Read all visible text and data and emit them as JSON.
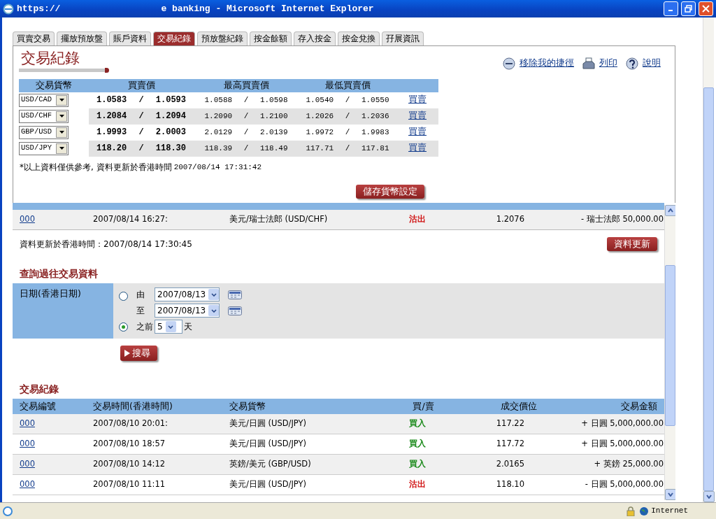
{
  "window": {
    "title_start": "https://",
    "title_end": "e banking - Microsoft Internet Explorer"
  },
  "tabs": [
    {
      "label": "買賣交易",
      "selected": false
    },
    {
      "label": "擺放預放盤",
      "selected": false
    },
    {
      "label": "賬戶資料",
      "selected": false
    },
    {
      "label": "交易紀錄",
      "selected": true
    },
    {
      "label": "預放盤紀錄",
      "selected": false
    },
    {
      "label": "按金餘額",
      "selected": false
    },
    {
      "label": "存入按金",
      "selected": false
    },
    {
      "label": "按金兌換",
      "selected": false
    },
    {
      "label": "孖展資訊",
      "selected": false
    }
  ],
  "page_title": "交易紀錄",
  "links": [
    {
      "label": "移除我的捷徑"
    },
    {
      "label": "列印"
    },
    {
      "label": "說明"
    }
  ],
  "rates": {
    "columns": [
      "交易貨幣",
      "買賣價",
      "最高買賣價",
      "最低買賣價"
    ],
    "rows": [
      {
        "pair": "USD/CAD",
        "price": "1.0583 / 1.0593",
        "high": "1.0588 / 1.0598",
        "low": "1.0540 / 1.0550",
        "action": "買賣"
      },
      {
        "pair": "USD/CHF",
        "price": "1.2084 / 1.2094",
        "high": "1.2090 / 1.2100",
        "low": "1.2026 / 1.2036",
        "action": "買賣"
      },
      {
        "pair": "GBP/USD",
        "price": "1.9993 / 2.0003",
        "high": "2.0129 / 2.0139",
        "low": "1.9972 / 1.9983",
        "action": "買賣"
      },
      {
        "pair": "USD/JPY",
        "price": "118.20 / 118.30",
        "high": "118.39 / 118.49",
        "low": "117.71 / 117.81",
        "action": "買賣"
      }
    ],
    "note": "*以上資料僅供參考, 資料更新於香港時間",
    "note_time": "2007/08/14 17:31:42",
    "save_button": "儲存貨幣設定"
  },
  "current_trades": {
    "rows": [
      {
        "id": "000",
        "time": "2007/08/14 16:27:",
        "pair": "美元/瑞士法郎 (USD/CHF)",
        "side": "沽出",
        "kind": "sell",
        "price": "1.2076",
        "amount": "- 瑞士法郎 50,000.00"
      }
    ],
    "updated": "資料更新於香港時間：2007/08/14 17:30:45",
    "refresh_button": "資料更新"
  },
  "history_query": {
    "title": "查詢過往交易資料",
    "label": "日期(香港日期)",
    "options": [
      {
        "kind": "range",
        "selected": false,
        "from_label": "由",
        "from": "2007/08/13",
        "to_label": "至",
        "to": "2007/08/13"
      },
      {
        "kind": "days",
        "selected": true,
        "prefix": "之前",
        "days": "5",
        "suffix": "天"
      }
    ],
    "search_button": "搜尋"
  },
  "history": {
    "title": "交易紀錄",
    "columns": [
      "交易編號",
      "交易時間(香港時間)",
      "交易貨幣",
      "買/賣",
      "成交價位",
      "交易金額"
    ],
    "rows": [
      {
        "id": "000",
        "time": "2007/08/10 20:01:",
        "pair": "美元/日圓 (USD/JPY)",
        "side": "買入",
        "kind": "buy",
        "price": "117.22",
        "amount": "+ 日圓 5,000,000.00"
      },
      {
        "id": "000",
        "time": "2007/08/10 18:57",
        "pair": "美元/日圓 (USD/JPY)",
        "side": "買入",
        "kind": "buy",
        "price": "117.72",
        "amount": "+ 日圓 5,000,000.00"
      },
      {
        "id": "000",
        "time": "2007/08/10 14:12",
        "pair": "英鎊/美元 (GBP/USD)",
        "side": "買入",
        "kind": "buy",
        "price": "2.0165",
        "amount": "+ 英鎊 25,000.00"
      },
      {
        "id": "000",
        "time": "2007/08/10 11:11",
        "pair": "美元/日圓 (USD/JPY)",
        "side": "沽出",
        "kind": "sell",
        "price": "118.10",
        "amount": "- 日圓 5,000,000.00"
      }
    ]
  },
  "status_bar": {
    "zone": "Internet"
  }
}
